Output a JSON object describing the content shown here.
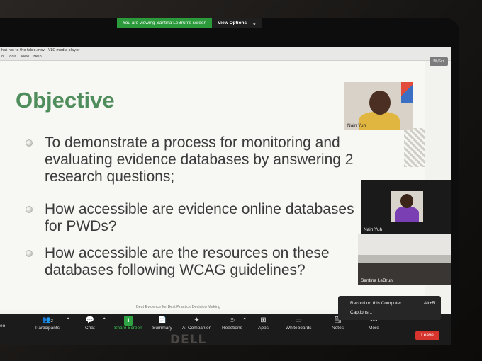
{
  "vlc": {
    "title": "hat not to the table.mov - VLC media player",
    "menu": [
      "o",
      "Tools",
      "View",
      "Help"
    ],
    "restore_label": "Fit/Scr"
  },
  "share_banner": {
    "notice": "You are viewing Santina LeBrun's screen",
    "view_options": "View Options",
    "chevron": "⌄"
  },
  "slide": {
    "title": "Objective",
    "bullets": [
      "To demonstrate a process for monitoring and evaluating evidence databases by answering 2 research questions;",
      " How accessible are evidence online databases for PWDs?",
      "How accessible are the resources on these databases following WCAG guidelines?"
    ],
    "footer": "Best Evidence for Best Practice Decision Making"
  },
  "participants": {
    "tile1_name": "Nain Yuh",
    "tile2_name": "Nain Yuh",
    "tile3_name": "Santina LeBrun"
  },
  "popup": {
    "record_label": "Record on this Computer",
    "record_hotkey": "Alt+R",
    "captions_label": "Captions..."
  },
  "toolbar": {
    "left_fragment": "eo",
    "participants_label": "Participants",
    "participants_count": "2",
    "chat_label": "Chat",
    "share_label": "Share Screen",
    "summary_label": "Summary",
    "ai_label": "AI Companion",
    "reactions_label": "Reactions",
    "apps_label": "Apps",
    "whiteboards_label": "Whiteboards",
    "notes_label": "Notes",
    "more_label": "More",
    "leave_label": "Leave"
  },
  "laptop_brand": "DELL",
  "colors": {
    "title_green": "#4f8e5c",
    "share_green": "#2b9a3b",
    "leave_red": "#d6342c",
    "toolbar_bg": "#1b1b1b"
  }
}
